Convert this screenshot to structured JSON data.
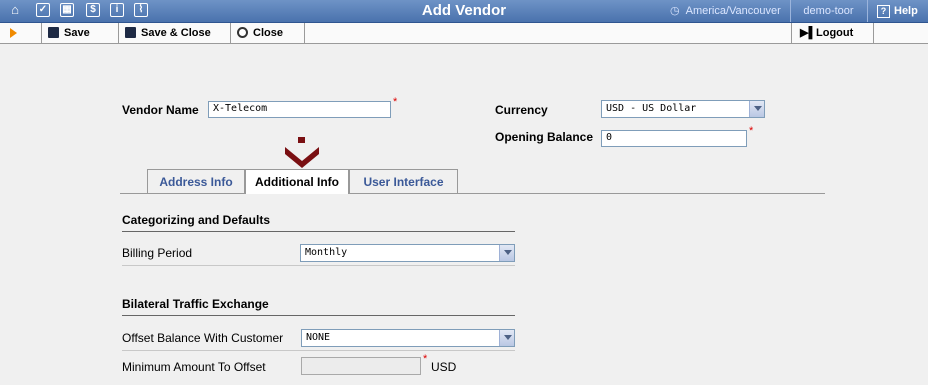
{
  "header": {
    "title": "Add Vendor",
    "timezone": "America/Vancouver",
    "user": "demo-toor",
    "help": "Help"
  },
  "toolbar": {
    "save_label": "Save",
    "save_close_label": "Save & Close",
    "close_label": "Close",
    "logout_label": "Logout"
  },
  "form": {
    "vendor_name_label": "Vendor Name",
    "vendor_name_value": "X-Telecom",
    "currency_label": "Currency",
    "currency_value": "USD - US Dollar",
    "opening_balance_label": "Opening Balance",
    "opening_balance_value": "0"
  },
  "tabs": [
    {
      "label": "Address Info"
    },
    {
      "label": "Additional Info"
    },
    {
      "label": "User Interface"
    }
  ],
  "sections": {
    "categorizing": {
      "title": "Categorizing and Defaults",
      "billing_period_label": "Billing Period",
      "billing_period_value": "Monthly"
    },
    "bilateral": {
      "title": "Bilateral Traffic Exchange",
      "offset_label": "Offset Balance With Customer",
      "offset_value": "NONE",
      "min_amount_label": "Minimum Amount To Offset",
      "min_amount_value": "",
      "min_amount_unit": "USD"
    }
  },
  "colors": {
    "header_bg": "#5a80b8",
    "accent_arrow": "#7a0f12",
    "required": "#dd0000"
  }
}
